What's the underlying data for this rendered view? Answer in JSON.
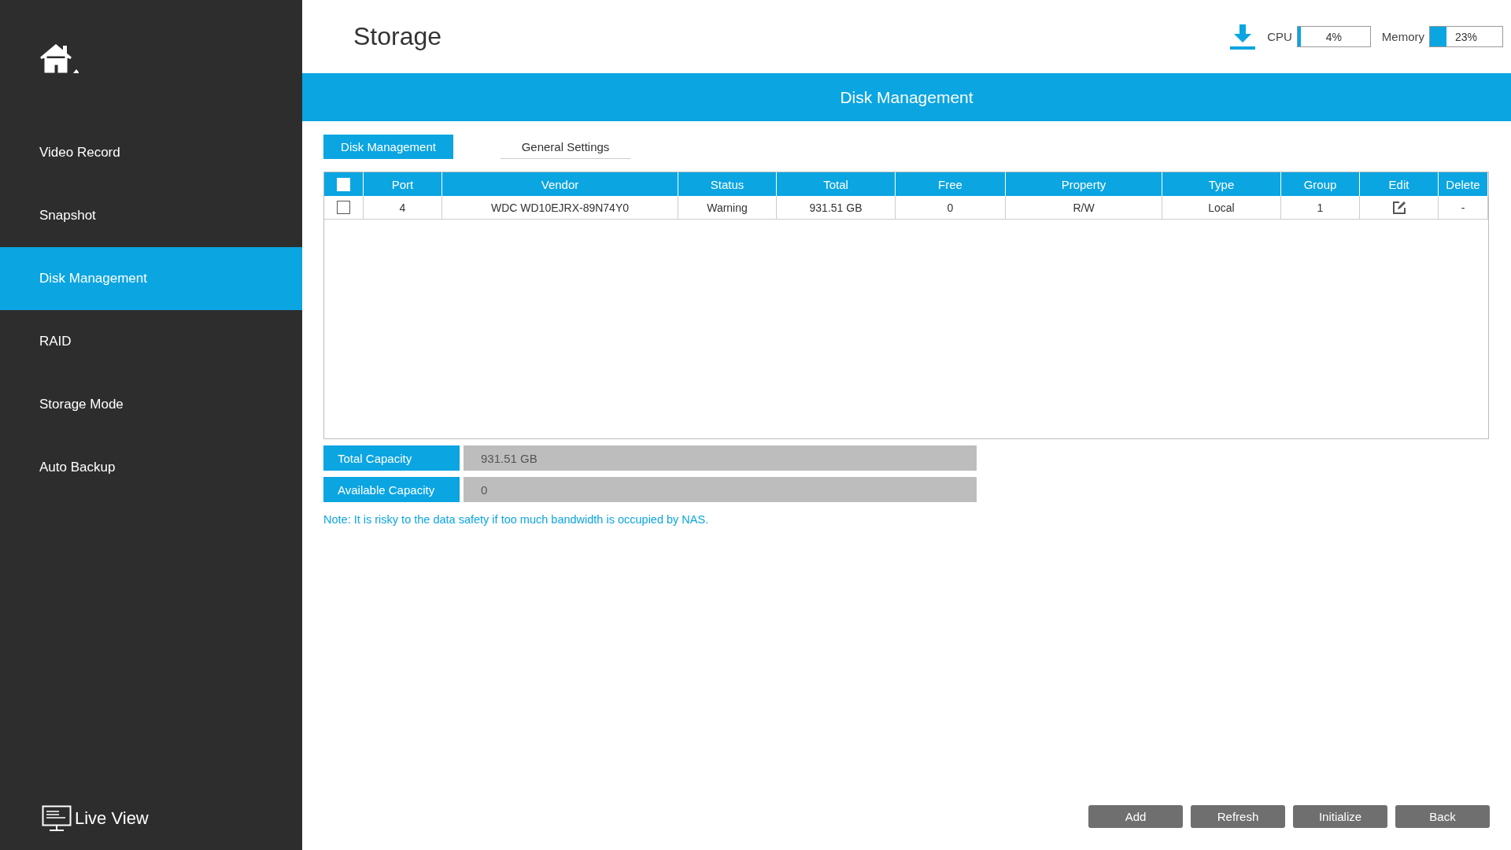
{
  "header": {
    "title": "Storage",
    "cpu": {
      "label": "CPU",
      "reading": "4%",
      "level": 0.04
    },
    "memory": {
      "label": "Memory",
      "reading": "23%",
      "level": 0.23
    }
  },
  "sidebar": {
    "items": [
      {
        "label": "Video Record",
        "selected": false
      },
      {
        "label": "Snapshot",
        "selected": false
      },
      {
        "label": "Disk Management",
        "selected": true
      },
      {
        "label": "RAID",
        "selected": false
      },
      {
        "label": "Storage Mode",
        "selected": false
      },
      {
        "label": "Auto Backup",
        "selected": false
      }
    ],
    "footer": "Live View"
  },
  "banner": "Disk Management",
  "tabs": [
    {
      "label": "Disk Management",
      "selected": true
    },
    {
      "label": "General Settings",
      "selected": false
    }
  ],
  "table": {
    "all_checked": false,
    "columns": [
      "Port",
      "Vendor",
      "Status",
      "Total",
      "Free",
      "Property",
      "Type",
      "Group",
      "Edit",
      "Delete"
    ],
    "rows": [
      {
        "checked": false,
        "cells": [
          "4",
          "WDC WD10EJRX-89N74Y0",
          "Warning",
          "931.51 GB",
          "0",
          "R/W",
          "Local",
          "1"
        ],
        "delete": "-"
      }
    ]
  },
  "capacity": [
    {
      "label": "Total Capacity",
      "value": "931.51 GB"
    },
    {
      "label": "Available Capacity",
      "value": "0"
    }
  ],
  "note": "Note: It is risky to the data safety if too much bandwidth is occupied by NAS.",
  "buttons": [
    "Add",
    "Refresh",
    "Initialize",
    "Back"
  ]
}
